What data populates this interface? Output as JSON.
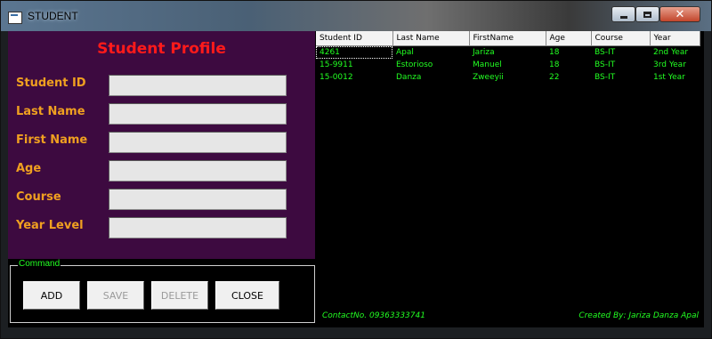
{
  "window": {
    "title": "STUDENT"
  },
  "profile": {
    "title": "Student Profile",
    "fields": [
      {
        "label": "Student ID",
        "value": ""
      },
      {
        "label": "Last Name",
        "value": ""
      },
      {
        "label": "First Name",
        "value": ""
      },
      {
        "label": "Age",
        "value": ""
      },
      {
        "label": "Course",
        "value": ""
      },
      {
        "label": "Year Level",
        "value": ""
      }
    ]
  },
  "command": {
    "label": "Command",
    "buttons": [
      {
        "label": "ADD",
        "enabled": true
      },
      {
        "label": "SAVE",
        "enabled": false
      },
      {
        "label": "DELETE",
        "enabled": false
      },
      {
        "label": "CLOSE",
        "enabled": true
      }
    ]
  },
  "grid": {
    "columns": [
      "Student ID",
      "Last Name",
      "FirstName",
      "Age",
      "Course",
      "Year"
    ],
    "rows": [
      [
        "4261",
        "Apal",
        "Jariza",
        "18",
        "BS-IT",
        "2nd Year"
      ],
      [
        "15-9911",
        "Estorioso",
        "Manuel",
        "18",
        "BS-IT",
        "3rd Year"
      ],
      [
        "15-0012",
        "Danza",
        "Zweeyii",
        "22",
        "BS-IT",
        "1st Year"
      ]
    ]
  },
  "footer": {
    "contact": "ContactNo. 09363333741",
    "credit": "Created By: Jariza Danza Apal"
  },
  "colors": {
    "panel_bg": "#3d0a40",
    "title_red": "#ff1a1a",
    "label_orange": "#f0a020",
    "grid_text_green": "#22ff22"
  }
}
